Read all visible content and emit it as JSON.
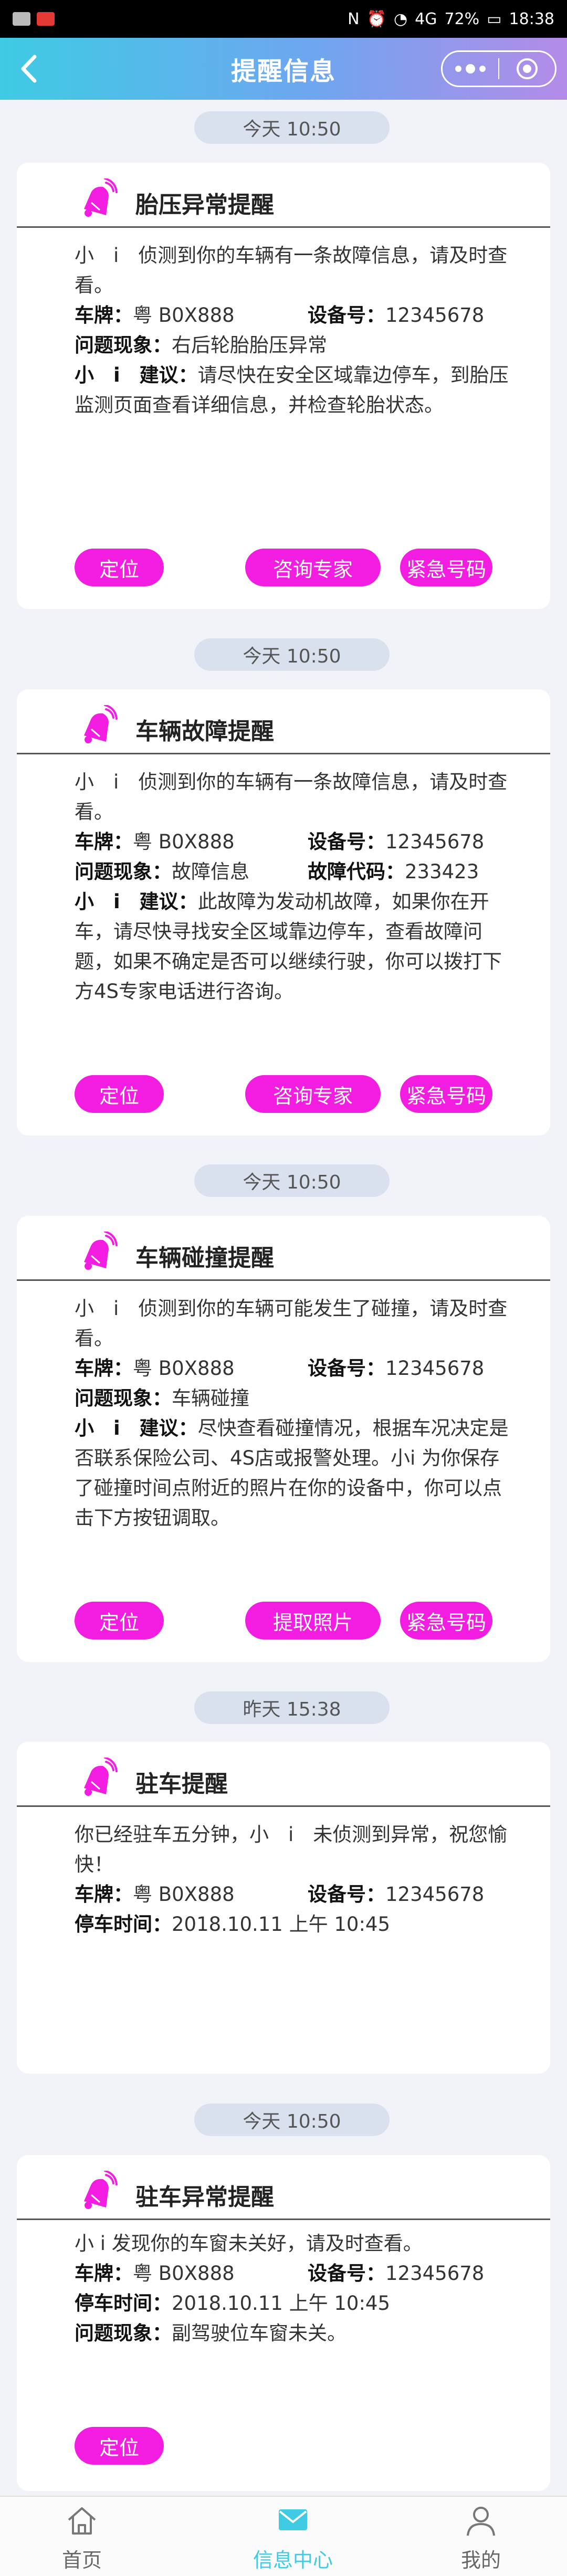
{
  "status_bar": {
    "battery": "72%",
    "time": "18:38",
    "signal": "4G"
  },
  "header": {
    "title": "提醒信息"
  },
  "messages": [
    {
      "time": "今天 10:50",
      "title": "胎压异常提醒",
      "intro": "小　i　侦测到你的车辆有一条故障信息，请及时查看。",
      "plate_label": "车牌：",
      "plate": "粤 B0X888",
      "device_label": "设备号：",
      "device": "12345678",
      "issue_label": "问题现象：",
      "issue": "右后轮胎胎压异常",
      "advice_label": "小　i　建议：",
      "advice": "请尽快在安全区域靠边停车，到胎压监测页面查看详细信息，并检查轮胎状态。",
      "buttons": [
        "定位",
        "咨询专家",
        "紧急号码"
      ]
    },
    {
      "time": "今天 10:50",
      "title": "车辆故障提醒",
      "intro": "小　i　侦测到你的车辆有一条故障信息，请及时查看。",
      "plate_label": "车牌：",
      "plate": "粤 B0X888",
      "device_label": "设备号：",
      "device": "12345678",
      "issue_label": "问题现象：",
      "issue": "故障信息",
      "code_label": "故障代码：",
      "code": "233423",
      "advice_label": "小　i　建议：",
      "advice": "此故障为发动机故障，如果你在开车，请尽快寻找安全区域靠边停车，查看故障问题，如果不确定是否可以继续行驶，你可以拨打下方4S专家电话进行咨询。",
      "buttons": [
        "定位",
        "咨询专家",
        "紧急号码"
      ]
    },
    {
      "time": "今天 10:50",
      "title": "车辆碰撞提醒",
      "intro": "小　i　侦测到你的车辆可能发生了碰撞，请及时查看。",
      "plate_label": "车牌：",
      "plate": "粤 B0X888",
      "device_label": "设备号：",
      "device": "12345678",
      "issue_label": "问题现象：",
      "issue": "车辆碰撞",
      "advice_label": "小　i　建议：",
      "advice": "尽快查看碰撞情况，根据车况决定是否联系保险公司、4S店或报警处理。小i 为你保存了碰撞时间点附近的照片在你的设备中，你可以点击下方按钮调取。",
      "buttons": [
        "定位",
        "提取照片",
        "紧急号码"
      ]
    },
    {
      "time": "昨天 15:38",
      "title": "驻车提醒",
      "intro": "你已经驻车五分钟，小　i　未侦测到异常，祝您愉快！",
      "plate_label": "车牌：",
      "plate": "粤 B0X888",
      "device_label": "设备号：",
      "device": "12345678",
      "park_label": "停车时间：",
      "park_time": "2018.10.11  上午 10:45"
    },
    {
      "time": "今天 10:50",
      "title": "驻车异常提醒",
      "intro": "小 i 发现你的车窗未关好，请及时查看。",
      "plate_label": "车牌：",
      "plate": "粤 B0X888",
      "device_label": "设备号：",
      "device": "12345678",
      "park_label": "停车时间：",
      "park_time": "2018.10.11  上午 10:45",
      "issue_label": "问题现象：",
      "issue": "副驾驶位车窗未关。",
      "buttons": [
        "定位"
      ]
    }
  ],
  "tabbar": {
    "home": "首页",
    "messages": "信息中心",
    "mine": "我的"
  },
  "colors": {
    "accent_pink": "#f21de0",
    "header_start": "#3ecbe3",
    "header_end": "#b48be8",
    "active_tab": "#3ecbe3"
  }
}
